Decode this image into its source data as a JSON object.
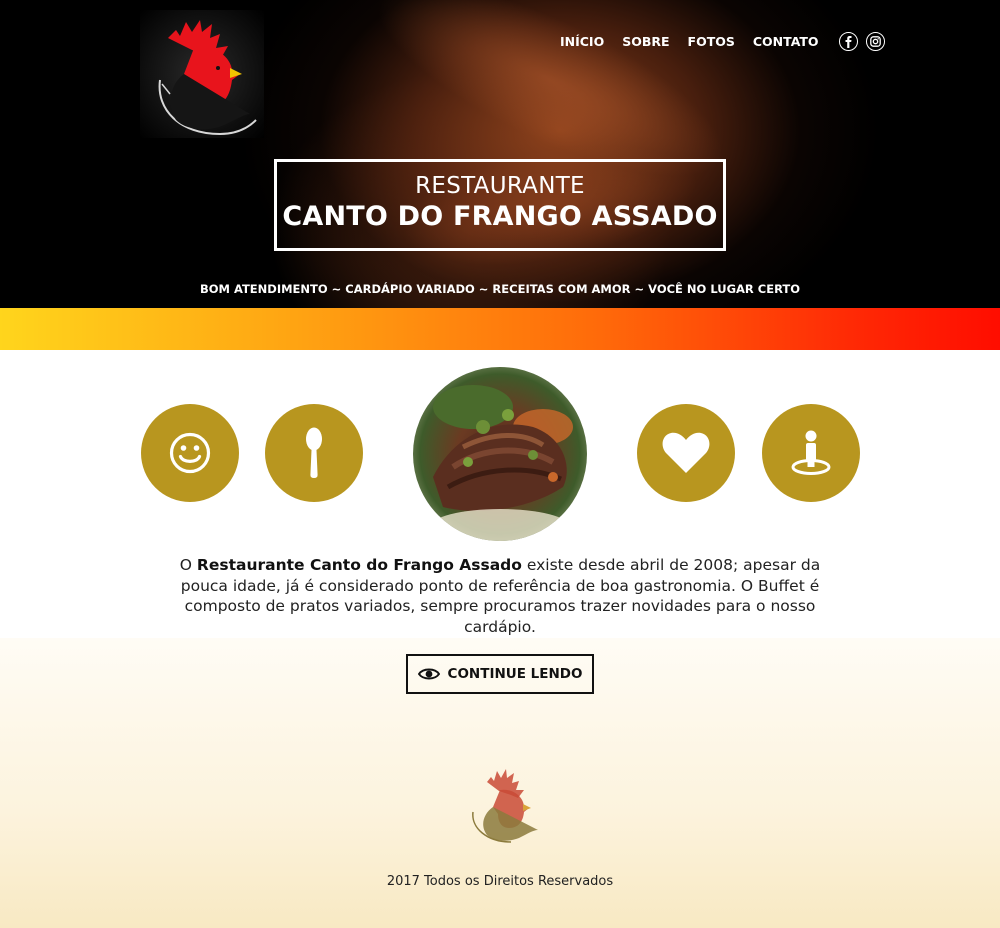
{
  "nav": {
    "items": [
      {
        "label": "INÍCIO"
      },
      {
        "label": "SOBRE"
      },
      {
        "label": "FOTOS"
      },
      {
        "label": "CONTATO"
      }
    ],
    "social": [
      "facebook-icon",
      "instagram-icon"
    ]
  },
  "hero": {
    "subtitle": "RESTAURANTE",
    "title": "CANTO DO FRANGO ASSADO",
    "tagline": "BOM ATENDIMENTO ~ CARDÁPIO VARIADO ~ RECEITAS COM AMOR ~ VOCÊ NO LUGAR CERTO"
  },
  "features": {
    "icons": [
      "smile-icon",
      "spoon-icon",
      "heart-icon",
      "location-person-icon"
    ]
  },
  "about": {
    "prefix": "O ",
    "restaurant_name": "Restaurante Canto do Frango Assado",
    "text": " existe desde abril de 2008; apesar da pouca idade, já é considerado ponto de referência de boa gastronomia. O Buffet é composto de pratos variados, sempre procuramos trazer novidades para o nosso cardápio."
  },
  "cta": {
    "label": "CONTINUE LENDO"
  },
  "footer": {
    "copyright": "2017 Todos os Direitos Reservados"
  },
  "colors": {
    "accent_gold": "#b8961f",
    "strip_start": "#ffd51c",
    "strip_end": "#ff0d00"
  }
}
